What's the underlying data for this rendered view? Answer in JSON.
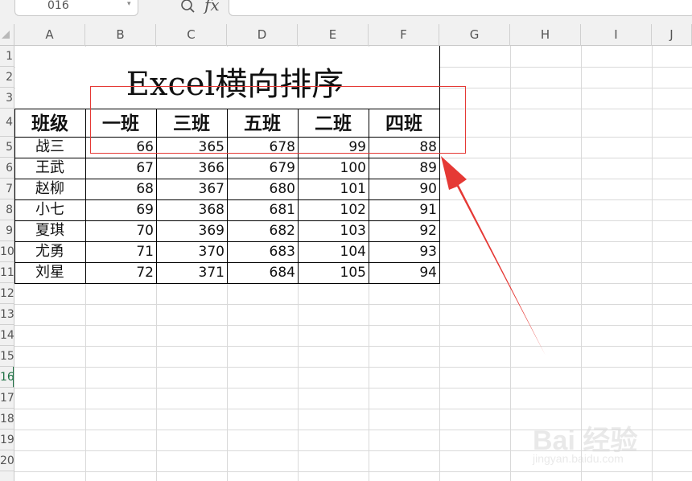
{
  "formula_bar": {
    "name_box_value": "016",
    "fx_label": "fx"
  },
  "columns": [
    "A",
    "B",
    "C",
    "D",
    "E",
    "F",
    "G",
    "H",
    "I",
    "J"
  ],
  "row_labels": [
    "1",
    "2",
    "3",
    "4",
    "5",
    "6",
    "7",
    "8",
    "9",
    "10",
    "11",
    "12",
    "13",
    "14",
    "15",
    "16",
    "17",
    "18",
    "19",
    "20"
  ],
  "active_row": "16",
  "sheet": {
    "title": "Excel横向排序",
    "headers": [
      "班级",
      "一班",
      "三班",
      "五班",
      "二班",
      "四班"
    ],
    "rows": [
      {
        "name": "战三",
        "values": [
          "66",
          "365",
          "678",
          "99",
          "88"
        ]
      },
      {
        "name": "王武",
        "values": [
          "67",
          "366",
          "679",
          "100",
          "89"
        ]
      },
      {
        "name": "赵柳",
        "values": [
          "68",
          "367",
          "680",
          "101",
          "90"
        ]
      },
      {
        "name": "小七",
        "values": [
          "69",
          "368",
          "681",
          "102",
          "91"
        ]
      },
      {
        "name": "夏琪",
        "values": [
          "70",
          "369",
          "682",
          "103",
          "92"
        ]
      },
      {
        "name": "尤勇",
        "values": [
          "71",
          "370",
          "683",
          "104",
          "93"
        ]
      },
      {
        "name": "刘星",
        "values": [
          "72",
          "371",
          "684",
          "105",
          "94"
        ]
      }
    ]
  },
  "annotation": {
    "box_color": "#e53935",
    "arrow_color": "#e53935"
  },
  "watermark": {
    "text": "Bai 经验",
    "url": "jingyan.baidu.com"
  }
}
